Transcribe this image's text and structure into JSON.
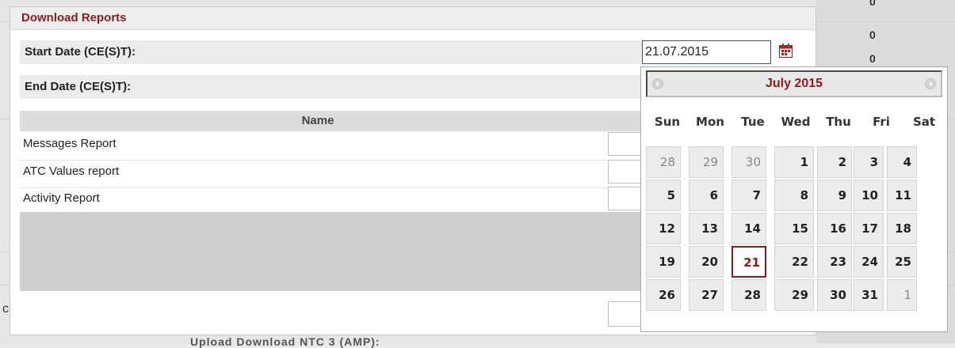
{
  "dialog": {
    "title": "Download Reports",
    "start_date_label": "Start Date (CE(S)T):",
    "end_date_label": "End Date (CE(S)T):",
    "start_date_value": "21.07.2015",
    "name_header": "Name",
    "reports": [
      {
        "label": "Messages Report"
      },
      {
        "label": "ATC Values report"
      },
      {
        "label": "Activity Report"
      }
    ]
  },
  "background": {
    "values": [
      "0",
      "0",
      "0"
    ],
    "bottom_text": "Upload   Download   NTC 3 (AMP):",
    "left_letter": "c"
  },
  "calendar": {
    "title": "July 2015",
    "weekdays": [
      "Sun",
      "Mon",
      "Tue",
      "Wed",
      "Thu",
      "Fri",
      "Sat"
    ],
    "weeks": [
      [
        "28",
        "29",
        "30",
        "1",
        "2",
        "3",
        "4"
      ],
      [
        "5",
        "6",
        "7",
        "8",
        "9",
        "10",
        "11"
      ],
      [
        "12",
        "13",
        "14",
        "15",
        "16",
        "17",
        "18"
      ],
      [
        "19",
        "20",
        "21",
        "22",
        "23",
        "24",
        "25"
      ],
      [
        "26",
        "27",
        "28",
        "29",
        "30",
        "31",
        "1"
      ]
    ],
    "other_month": [
      [
        0,
        0
      ],
      [
        0,
        1
      ],
      [
        0,
        2
      ],
      [
        4,
        6
      ]
    ],
    "selected": [
      3,
      2
    ],
    "accent_color": "#8a1c1c"
  }
}
